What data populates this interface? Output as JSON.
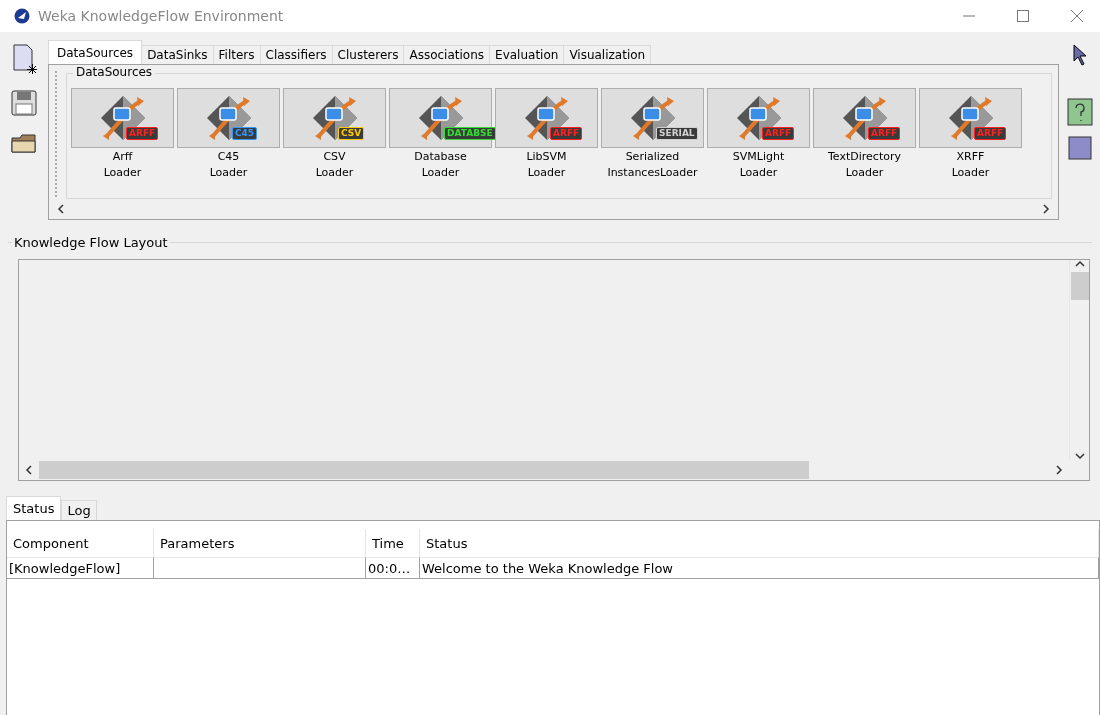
{
  "window": {
    "title": "Weka KnowledgeFlow Environment"
  },
  "tabs": [
    {
      "label": "DataSources",
      "selected": true
    },
    {
      "label": "DataSinks",
      "selected": false
    },
    {
      "label": "Filters",
      "selected": false
    },
    {
      "label": "Classifiers",
      "selected": false
    },
    {
      "label": "Clusterers",
      "selected": false
    },
    {
      "label": "Associations",
      "selected": false
    },
    {
      "label": "Evaluation",
      "selected": false
    },
    {
      "label": "Visualization",
      "selected": false
    }
  ],
  "palette": {
    "title": "DataSources",
    "items": [
      {
        "badge": "ARFF",
        "color": "#ff2020",
        "label": [
          "Arff",
          "Loader"
        ]
      },
      {
        "badge": "C45",
        "color": "#3399ff",
        "label": [
          "C45",
          "Loader"
        ]
      },
      {
        "badge": "CSV",
        "color": "#ffcc00",
        "label": [
          "CSV",
          "Loader"
        ]
      },
      {
        "badge": "DATABSE",
        "color": "#33dd33",
        "label": [
          "Database",
          "Loader"
        ]
      },
      {
        "badge": "ARFF",
        "color": "#ff2020",
        "label": [
          "LibSVM",
          "Loader"
        ]
      },
      {
        "badge": "SERIAL",
        "color": "#d0d0d0",
        "label": [
          "Serialized",
          "InstancesLoader"
        ]
      },
      {
        "badge": "ARFF",
        "color": "#ff2020",
        "label": [
          "SVMLight",
          "Loader"
        ]
      },
      {
        "badge": "ARFF",
        "color": "#ff2020",
        "label": [
          "TextDirectory",
          "Loader"
        ]
      },
      {
        "badge": "ARFF",
        "color": "#ff2020",
        "label": [
          "XRFF",
          "Loader"
        ]
      }
    ]
  },
  "layout": {
    "title": "Knowledge Flow Layout"
  },
  "bottom_tabs": [
    {
      "label": "Status",
      "selected": true
    },
    {
      "label": "Log",
      "selected": false
    }
  ],
  "status_table": {
    "columns": [
      "Component",
      "Parameters",
      "Time",
      "Status"
    ],
    "rows": [
      [
        "[KnowledgeFlow]",
        "",
        "00:0…",
        "Welcome to the Weka Knowledge Flow"
      ]
    ]
  }
}
